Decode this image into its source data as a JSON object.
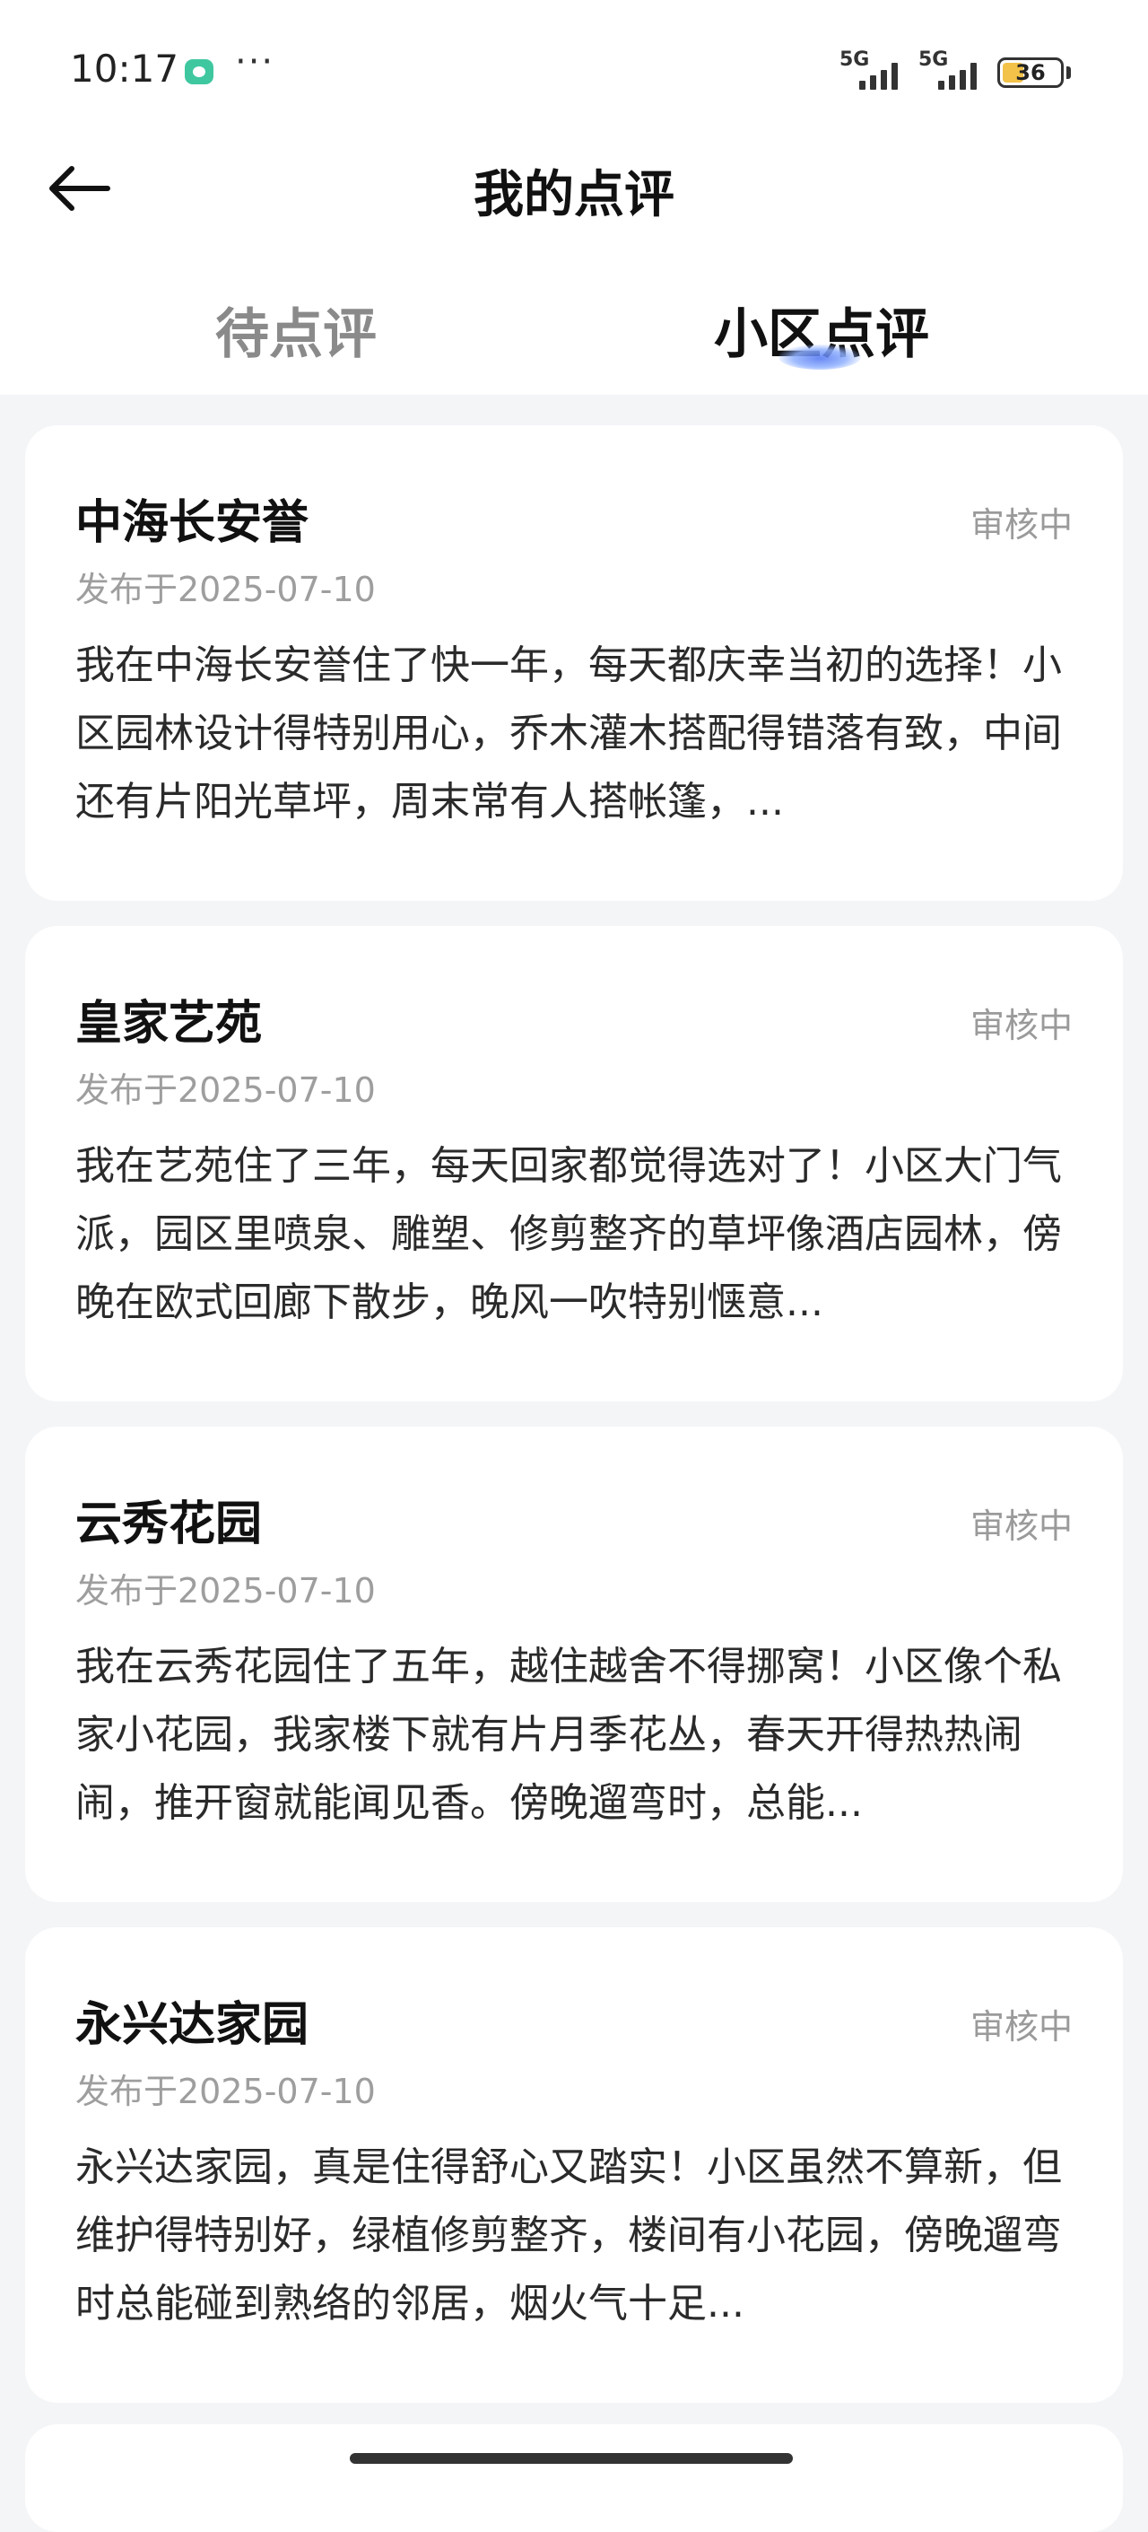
{
  "status_bar": {
    "time": "10:17",
    "more": "···",
    "signal1_label": "5G",
    "signal2_label": "5G",
    "battery": "36"
  },
  "header": {
    "title": "我的点评",
    "back_icon": "arrow-left-icon"
  },
  "tabs": [
    {
      "label": "待点评",
      "active": false
    },
    {
      "label": "小区点评",
      "active": true
    }
  ],
  "colors": {
    "accent": "#4f74f0",
    "background": "#f4f5f7",
    "card": "#ffffff",
    "status_text": "#9a9a9a"
  },
  "reviews": [
    {
      "title": "中海长安誉",
      "status": "审核中",
      "date": "发布于2025-07-10",
      "text": "我在中海长安誉住了快一年，每天都庆幸当初的选择！小区园林设计得特别用心，乔木灌木搭配得错落有致，中间还有片阳光草坪，周末常有人搭帐篷，..."
    },
    {
      "title": "皇家艺苑",
      "status": "审核中",
      "date": "发布于2025-07-10",
      "text": "我在艺苑住了三年，每天回家都觉得选对了！小区大门气派，园区里喷泉、雕塑、修剪整齐的草坪像酒店园林，傍晚在欧式回廊下散步，晚风一吹特别惬意..."
    },
    {
      "title": "云秀花园",
      "status": "审核中",
      "date": "发布于2025-07-10",
      "text": "我在云秀花园住了五年，越住越舍不得挪窝！小区像个私家小花园，我家楼下就有片月季花丛，春天开得热热闹闹，推开窗就能闻见香。傍晚遛弯时，总能..."
    },
    {
      "title": "永兴达家园",
      "status": "审核中",
      "date": "发布于2025-07-10",
      "text": "永兴达家园，真是住得舒心又踏实！小区虽然不算新，但维护得特别好，绿植修剪整齐，楼间有小花园，傍晚遛弯时总能碰到熟络的邻居，烟火气十足..."
    }
  ]
}
